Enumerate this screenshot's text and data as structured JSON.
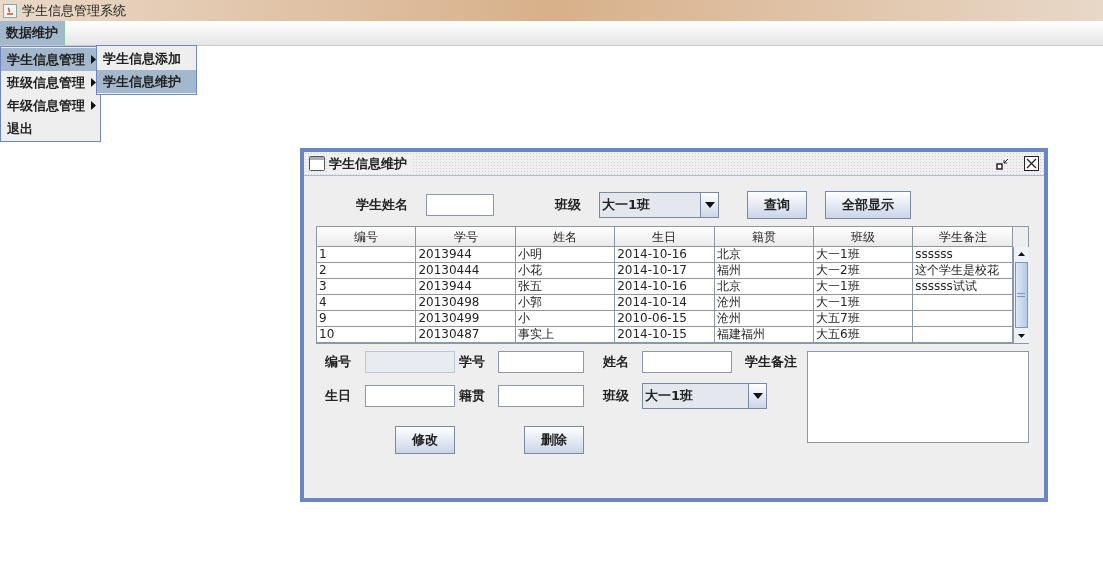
{
  "window": {
    "title": "学生信息管理系统"
  },
  "menubar": [
    {
      "label": "数据维护",
      "selected": true
    }
  ],
  "menu": [
    {
      "label": "学生信息管理",
      "has_submenu": true,
      "selected": true
    },
    {
      "label": "班级信息管理",
      "has_submenu": true,
      "selected": false
    },
    {
      "label": "年级信息管理",
      "has_submenu": true,
      "selected": false
    },
    {
      "label": "退出",
      "has_submenu": false,
      "selected": false
    }
  ],
  "submenu": [
    {
      "label": "学生信息添加",
      "selected": false
    },
    {
      "label": "学生信息维护",
      "selected": true
    }
  ],
  "internal_frame": {
    "title": "学生信息维护",
    "search": {
      "name_label": "学生姓名",
      "class_label": "班级",
      "class_value": "大一1班",
      "buttons": [
        "查询",
        "全部显示"
      ]
    },
    "table": {
      "columns": [
        "编号",
        "学号",
        "姓名",
        "生日",
        "籍贯",
        "班级",
        "学生备注"
      ],
      "rows": [
        [
          "1",
          "2013944",
          "小明",
          "2014-10-16",
          "北京",
          "大一1班",
          "ssssss"
        ],
        [
          "2",
          "20130444",
          "小花",
          "2014-10-17",
          "福州",
          "大一2班",
          "这个学生是校花"
        ],
        [
          "3",
          "2013944",
          "张五",
          "2014-10-16",
          "北京",
          "大一1班",
          "ssssss试试"
        ],
        [
          "4",
          "20130498",
          "小郭",
          "2014-10-14",
          "沧州",
          "大一1班",
          ""
        ],
        [
          "9",
          "20130499",
          "小",
          "2010-06-15",
          "沧州",
          "大五7班",
          ""
        ],
        [
          "10",
          "20130487",
          "事实上",
          "2014-10-15",
          "福建福州",
          "大五6班",
          ""
        ]
      ]
    },
    "form": {
      "rows": [
        [
          {
            "kind": "field",
            "label": "编号",
            "disabled": true
          },
          {
            "kind": "field",
            "label": "学号",
            "disabled": false
          },
          {
            "kind": "field",
            "label": "姓名",
            "disabled": false
          }
        ],
        [
          {
            "kind": "field",
            "label": "生日",
            "disabled": false
          },
          {
            "kind": "field",
            "label": "籍贯",
            "disabled": false
          },
          {
            "kind": "combo",
            "label": "班级",
            "value": "大一1班"
          }
        ]
      ],
      "note_label": "学生备注",
      "buttons": [
        "修改",
        "删除"
      ]
    }
  }
}
